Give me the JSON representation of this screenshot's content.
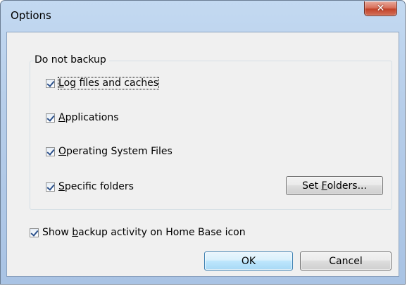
{
  "window": {
    "title": "Options",
    "close_glyph": "✕"
  },
  "group": {
    "legend": "Do not backup",
    "items": [
      {
        "prefix": "",
        "accel": "L",
        "rest": "og files and caches",
        "checked": true,
        "focused": true
      },
      {
        "prefix": "",
        "accel": "A",
        "rest": "pplications",
        "checked": true,
        "focused": false
      },
      {
        "prefix": "",
        "accel": "O",
        "rest": "perating System Files",
        "checked": true,
        "focused": false
      },
      {
        "prefix": "",
        "accel": "S",
        "rest": "pecific folders",
        "checked": true,
        "focused": false
      }
    ],
    "set_folders": {
      "prefix": "Set ",
      "accel": "F",
      "rest": "olders..."
    }
  },
  "show_activity": {
    "prefix": "Show ",
    "accel": "b",
    "rest": "ackup activity on Home Base icon",
    "checked": true
  },
  "buttons": {
    "ok": "OK",
    "cancel": "Cancel"
  }
}
